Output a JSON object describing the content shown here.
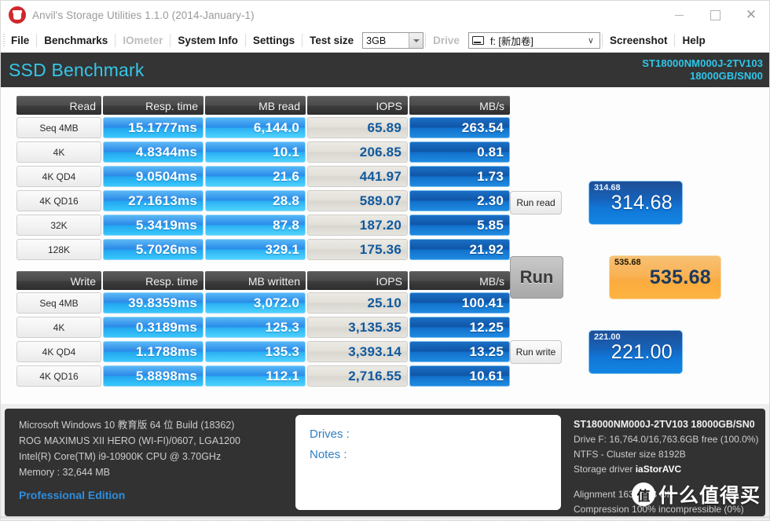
{
  "window": {
    "title": "Anvil's Storage Utilities 1.1.0 (2014-January-1)",
    "icon": "anvil-icon",
    "minimize": "minimize-icon",
    "maximize": "maximize-icon",
    "close": "close-icon"
  },
  "menu": {
    "items": [
      {
        "label": "File",
        "disabled": false
      },
      {
        "label": "Benchmarks",
        "disabled": false
      },
      {
        "label": "IOmeter",
        "disabled": true
      },
      {
        "label": "System Info",
        "disabled": false
      },
      {
        "label": "Settings",
        "disabled": false
      }
    ],
    "test_size_label": "Test size",
    "test_size_value": "3GB",
    "drive_label": "Drive",
    "drive_value": "f: [新加卷]",
    "screenshot_label": "Screenshot",
    "help_label": "Help"
  },
  "band": {
    "title": "SSD Benchmark",
    "drive_model": "ST18000NM000J-2TV103",
    "drive_capacity": "18000GB/SN00",
    "accent_color": "#35c7e8",
    "bg_color": "#343434"
  },
  "read_table": {
    "headers": [
      "Read",
      "Resp. time",
      "MB read",
      "IOPS",
      "MB/s"
    ],
    "rows": [
      {
        "label": "Seq 4MB",
        "resp": "15.1777ms",
        "mb": "6,144.0",
        "iops": "65.89",
        "mbs": "263.54"
      },
      {
        "label": "4K",
        "resp": "4.8344ms",
        "mb": "10.1",
        "iops": "206.85",
        "mbs": "0.81"
      },
      {
        "label": "4K QD4",
        "resp": "9.0504ms",
        "mb": "21.6",
        "iops": "441.97",
        "mbs": "1.73"
      },
      {
        "label": "4K QD16",
        "resp": "27.1613ms",
        "mb": "28.8",
        "iops": "589.07",
        "mbs": "2.30"
      },
      {
        "label": "32K",
        "resp": "5.3419ms",
        "mb": "87.8",
        "iops": "187.20",
        "mbs": "5.85"
      },
      {
        "label": "128K",
        "resp": "5.7026ms",
        "mb": "329.1",
        "iops": "175.36",
        "mbs": "21.92"
      }
    ]
  },
  "write_table": {
    "headers": [
      "Write",
      "Resp. time",
      "MB written",
      "IOPS",
      "MB/s"
    ],
    "rows": [
      {
        "label": "Seq 4MB",
        "resp": "39.8359ms",
        "mb": "3,072.0",
        "iops": "25.10",
        "mbs": "100.41"
      },
      {
        "label": "4K",
        "resp": "0.3189ms",
        "mb": "125.3",
        "iops": "3,135.35",
        "mbs": "12.25"
      },
      {
        "label": "4K QD4",
        "resp": "1.1788ms",
        "mb": "135.3",
        "iops": "3,393.14",
        "mbs": "13.25"
      },
      {
        "label": "4K QD16",
        "resp": "5.8898ms",
        "mb": "112.1",
        "iops": "2,716.55",
        "mbs": "10.61"
      }
    ]
  },
  "scores": {
    "read": {
      "button": "Run read",
      "small": "314.68",
      "big": "314.68",
      "color": "#1176d6"
    },
    "total": {
      "button": "Run",
      "small": "535.68",
      "big": "535.68",
      "color": "#fbab3e"
    },
    "write": {
      "button": "Run write",
      "small": "221.00",
      "big": "221.00",
      "color": "#1176d6"
    }
  },
  "sysinfo": {
    "os": "Microsoft Windows 10 教育版 64 位 Build (18362)",
    "board": "ROG MAXIMUS XII HERO (WI-FI)/0607, LGA1200",
    "cpu": "Intel(R) Core(TM) i9-10900K CPU @ 3.70GHz",
    "memory": "Memory : 32,644 MB",
    "edition": "Professional Edition",
    "edition_color": "#2e8ddd"
  },
  "notes": {
    "drives_label": "Drives :",
    "notes_label": "Notes :"
  },
  "driveinfo": {
    "model": "ST18000NM000J-2TV103 18000GB/SN0",
    "capacity": "Drive F: 16,764.0/16,763.6GB free (100.0%)",
    "filesystem": "NTFS - Cluster size 8192B",
    "driver_label": "Storage driver",
    "driver_value": "iaStorAVC",
    "alignment": "Alignment 16384KB OK",
    "compression": "Compression 100% incompressible (0%)"
  },
  "watermark": {
    "logo": "值",
    "text": "什么值得买"
  }
}
